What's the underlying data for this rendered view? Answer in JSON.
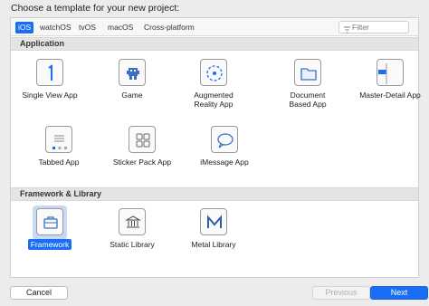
{
  "prompt": "Choose a template for your new project:",
  "tabs": [
    "iOS",
    "watchOS",
    "tvOS",
    "macOS",
    "Cross-platform"
  ],
  "active_tab": "iOS",
  "filter": {
    "placeholder": "Filter"
  },
  "sections": [
    {
      "title": "Application",
      "items": [
        {
          "label": "Single View App",
          "icon": "single-view-app-icon"
        },
        {
          "label": "Game",
          "icon": "game-icon"
        },
        {
          "label": "Augmented\nReality App",
          "icon": "augmented-reality-icon"
        },
        {
          "label": "Document\nBased App",
          "icon": "document-folder-icon"
        },
        {
          "label": "Master-Detail App",
          "icon": "master-detail-icon"
        },
        {
          "label": "Tabbed App",
          "icon": "tabbed-app-icon"
        },
        {
          "label": "Sticker Pack App",
          "icon": "sticker-grid-icon"
        },
        {
          "label": "iMessage App",
          "icon": "message-bubble-icon"
        }
      ]
    },
    {
      "title": "Framework & Library",
      "items": [
        {
          "label": "Framework",
          "icon": "toolbox-icon",
          "selected": true
        },
        {
          "label": "Static Library",
          "icon": "library-building-icon"
        },
        {
          "label": "Metal Library",
          "icon": "metal-icon"
        }
      ]
    }
  ],
  "buttons": {
    "cancel": "Cancel",
    "previous": "Previous",
    "next": "Next"
  },
  "colors": {
    "accent": "#1a6ef5",
    "selection_bg": "#c8d9f4"
  }
}
